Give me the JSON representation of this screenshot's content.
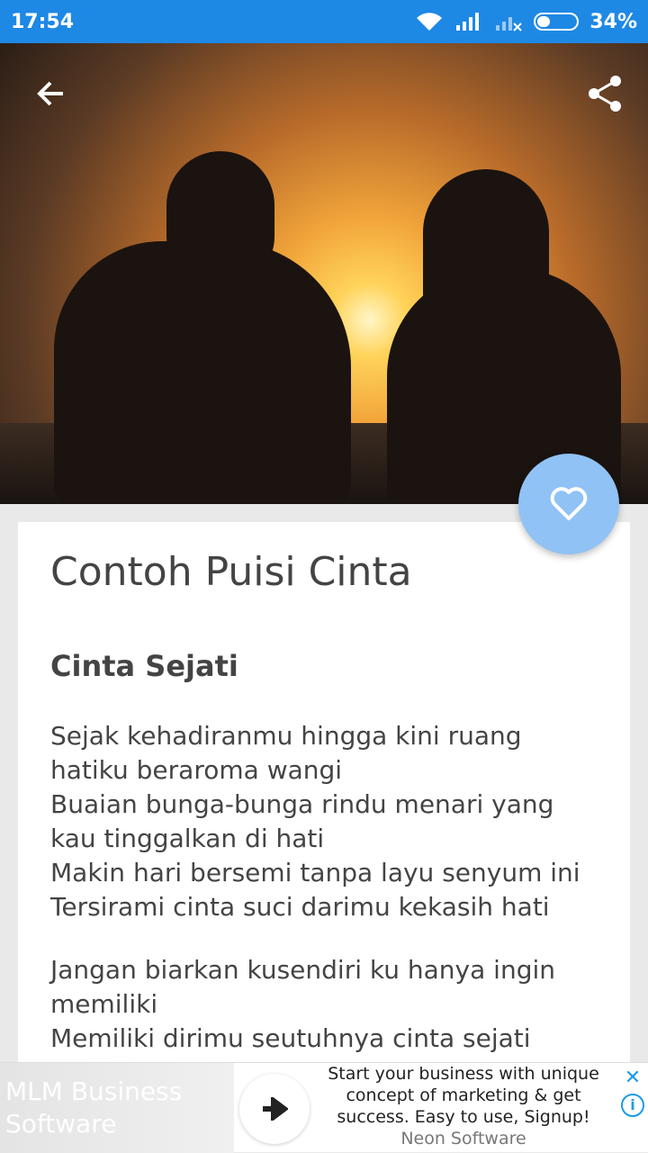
{
  "status_bar": {
    "time": "17:54",
    "battery": "34%"
  },
  "content": {
    "title": "Contoh Puisi Cinta",
    "poem_title": "Cinta Sejati",
    "stanzas": [
      [
        "Sejak kehadiranmu hingga kini ruang hatiku beraroma wangi",
        "Buaian bunga-bunga rindu menari yang kau tinggalkan di hati",
        "Makin hari bersemi tanpa layu senyum ini",
        "Tersirami cinta suci darimu kekasih hati"
      ],
      [
        "Jangan biarkan kusendiri ku hanya ingin memiliki",
        "Memiliki dirimu seutuhnya cinta sejati"
      ]
    ]
  },
  "ad": {
    "brand": "MLM Business Software",
    "text": "Start your business with unique concept of marketing & get success. Easy to use, Signup!",
    "sponsor": "Neon Software"
  },
  "icons": {
    "back": "arrow-left-icon",
    "share": "share-icon",
    "favorite": "heart-outline-icon",
    "ad_arrow": "arrow-right-icon",
    "ad_close": "close-icon",
    "ad_info": "info-icon"
  },
  "colors": {
    "status_bar": "#1e88e5",
    "fab": "#90c2f5",
    "text": "#444444"
  }
}
